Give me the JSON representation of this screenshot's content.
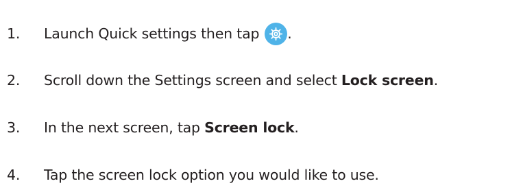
{
  "steps": [
    {
      "number": "1.",
      "text_before": "Launch Quick settings then tap",
      "icon": "gear-icon",
      "text_after": "."
    },
    {
      "number": "2.",
      "text_before": "Scroll down the Settings screen and select ",
      "bold": "Lock screen",
      "text_after": "."
    },
    {
      "number": "3.",
      "text_before": "In the next screen, tap ",
      "bold": "Screen lock",
      "text_after": "."
    },
    {
      "number": "4.",
      "text_before": "Tap the screen lock option you would like to use."
    }
  ],
  "colors": {
    "text": "#231f20",
    "icon_background": "#4fb3e8",
    "icon_foreground": "#ffffff"
  }
}
